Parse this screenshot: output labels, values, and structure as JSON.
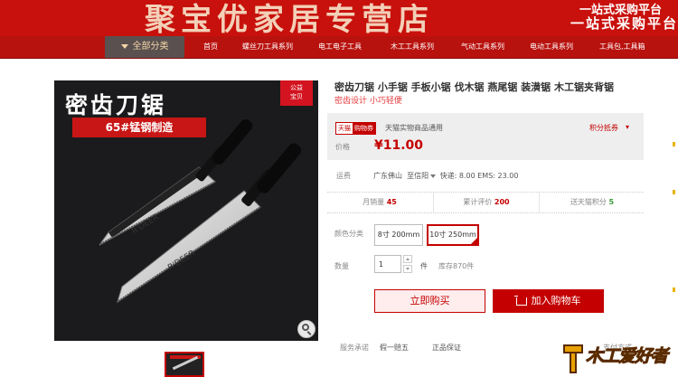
{
  "banner": {
    "title": "聚宝优家居专营店",
    "slogan_line1": "一站式采购平台",
    "slogan_line2": "一站式采购平台"
  },
  "nav": {
    "all_label": "全部分类",
    "items": [
      "首页",
      "螺丝刀工具系列",
      "电工电子工具",
      "木工工具系列",
      "气动工具系列",
      "电动工具系列",
      "工具包,工具箱"
    ]
  },
  "gallery": {
    "image_title": "密齿刀锯",
    "image_badge": "65#锰钢制造",
    "charity_badge": [
      "公益",
      "宝贝"
    ],
    "saw_brand": "R'DEER"
  },
  "product": {
    "title": "密齿刀锯 小手锯 手板小锯 伐木锯 燕尾锯 装潢锯 木工锯夹背锯",
    "subtitle": "密齿设计 小巧轻便",
    "tmall_a": "天猫",
    "tmall_b": "购物券",
    "tmall_desc": "天猫实物商品通用",
    "coupon": "积分抵券",
    "price_label": "价格",
    "price": "¥11.00",
    "ship_label": "运费",
    "ship_from": "广东佛山",
    "ship_to_prefix": "至",
    "ship_to": "信阳",
    "ship_fees": "快递: 8.00 EMS: 23.00",
    "stats": [
      {
        "label": "月销量",
        "value": "45"
      },
      {
        "label": "累计评价",
        "value": "200"
      },
      {
        "label": "送天猫积分",
        "value": "5"
      }
    ],
    "color_label": "颜色分类",
    "skus": [
      "8寸 200mm",
      "10寸 250mm"
    ],
    "qty_label": "数量",
    "qty_value": "1",
    "qty_unit": "件",
    "stock": "库存870件",
    "buy_now": "立即购买",
    "add_cart": "加入购物车",
    "promise_label": "服务承诺",
    "promise_items": [
      "假一赔五",
      "正品保证"
    ],
    "pay_label": "支付方式"
  },
  "watermark": "木工爱好者"
}
